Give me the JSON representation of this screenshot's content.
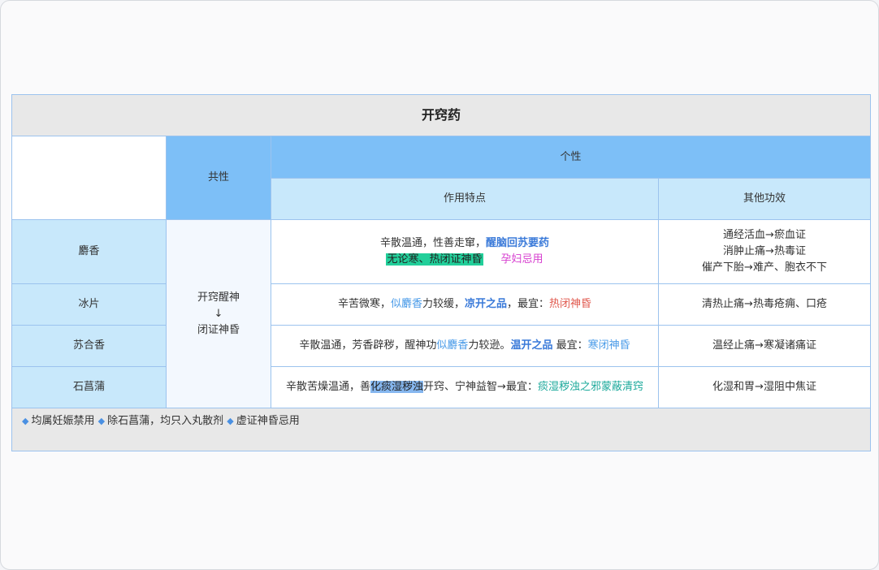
{
  "title": "开窍药",
  "headers": {
    "common": "共性",
    "individual": "个性",
    "features": "作用特点",
    "other": "其他功效"
  },
  "common_text": {
    "line1": "开窍醒神",
    "arrow": "↓",
    "line2": "闭证神昏"
  },
  "rows": [
    {
      "name": "麝香",
      "desc": {
        "a": "辛散温通，性善走窜，",
        "b": "醒脑回苏要药",
        "c": "无论寒、热闭证神昏",
        "d": "孕妇忌用"
      },
      "other": [
        "通经活血→瘀血证",
        "消肿止痛→热毒证",
        "催产下胎→难产、胞衣不下"
      ]
    },
    {
      "name": "冰片",
      "desc": {
        "a": "辛苦微寒，",
        "b": "似麝香",
        "c": "力较缓，",
        "d": "凉开之品",
        "e": "，最宜：",
        "f": "热闭神昏"
      },
      "other": [
        "清热止痛→热毒疮痈、口疮"
      ]
    },
    {
      "name": "苏合香",
      "desc": {
        "a": "辛散温通，芳香辟秽，醒神功",
        "b": "似麝香",
        "c": "力较逊。",
        "d": "温开之品",
        "e": " 最宜：",
        "f": "寒闭神昏"
      },
      "other": [
        "温经止痛→寒凝诸痛证"
      ]
    },
    {
      "name": "石菖蒲",
      "desc": {
        "a": "辛散苦燥温通，善",
        "b": "化痰湿秽浊",
        "c": "开窍、宁神益智→最宜：",
        "d": "痰湿秽浊之邪蒙蔽清窍"
      },
      "other": [
        "化湿和胃→湿阻中焦证"
      ]
    }
  ],
  "footer": {
    "bullet": "◆",
    "items": [
      "均属妊娠禁用",
      "除石菖蒲，均只入丸散剂",
      "虚证神昏忌用"
    ]
  },
  "colors": {
    "header_dark": "#7dbff7",
    "header_light": "#c8e8fb",
    "border": "#9cc3ee",
    "highlight_green": "#22cf9a",
    "highlight_blue": "#86b7ef",
    "text_blue": "#3a7ad9",
    "text_red": "#e0574c",
    "text_pink": "#d63ccf",
    "text_teal": "#1aa89a"
  }
}
